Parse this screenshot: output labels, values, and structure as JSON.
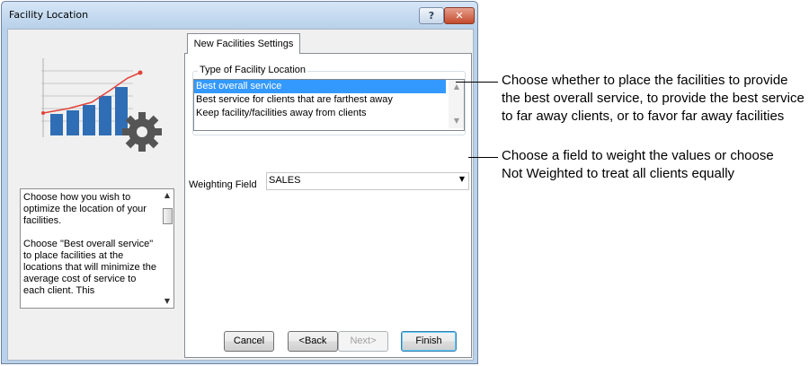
{
  "window": {
    "title": "Facility Location",
    "help_button": "?",
    "close_button": "✕"
  },
  "help_panel": {
    "paragraphs": [
      "Choose how you wish to optimize the location of your facilities.",
      "Choose \"Best overall service\" to place facilities at the locations that will minimize the average cost of service to each client. This"
    ],
    "scroll_up": "▲",
    "scroll_down": "▼"
  },
  "tab": {
    "label": "New Facilities Settings"
  },
  "facility_type": {
    "group_label": "Type of Facility Location",
    "options": [
      "Best overall service",
      "Best service for clients that are farthest away",
      "Keep facility/facilities away from clients"
    ],
    "selected": "Best overall service"
  },
  "weighting": {
    "label": "Weighting Field",
    "value": "SALES",
    "arrow": "▼"
  },
  "buttons": {
    "cancel": "Cancel",
    "back": "<Back",
    "next": "Next>",
    "finish": "Finish"
  },
  "annotations": {
    "type_callout": [
      "Choose whether to place the facilities to provide",
      "the best overall service, to provide the best service",
      "to far away clients, or to favor far away facilities"
    ],
    "weighting_callout": [
      "Choose a field to weight the values or choose",
      "Not Weighted to treat all clients equally"
    ]
  },
  "colors": {
    "selection": "#3399ff",
    "bars": "#2f6eb5",
    "trend_line": "#e0433a",
    "gear": "#555555"
  },
  "icons": {
    "wizard_art": "bar-chart-with-gear-icon"
  }
}
